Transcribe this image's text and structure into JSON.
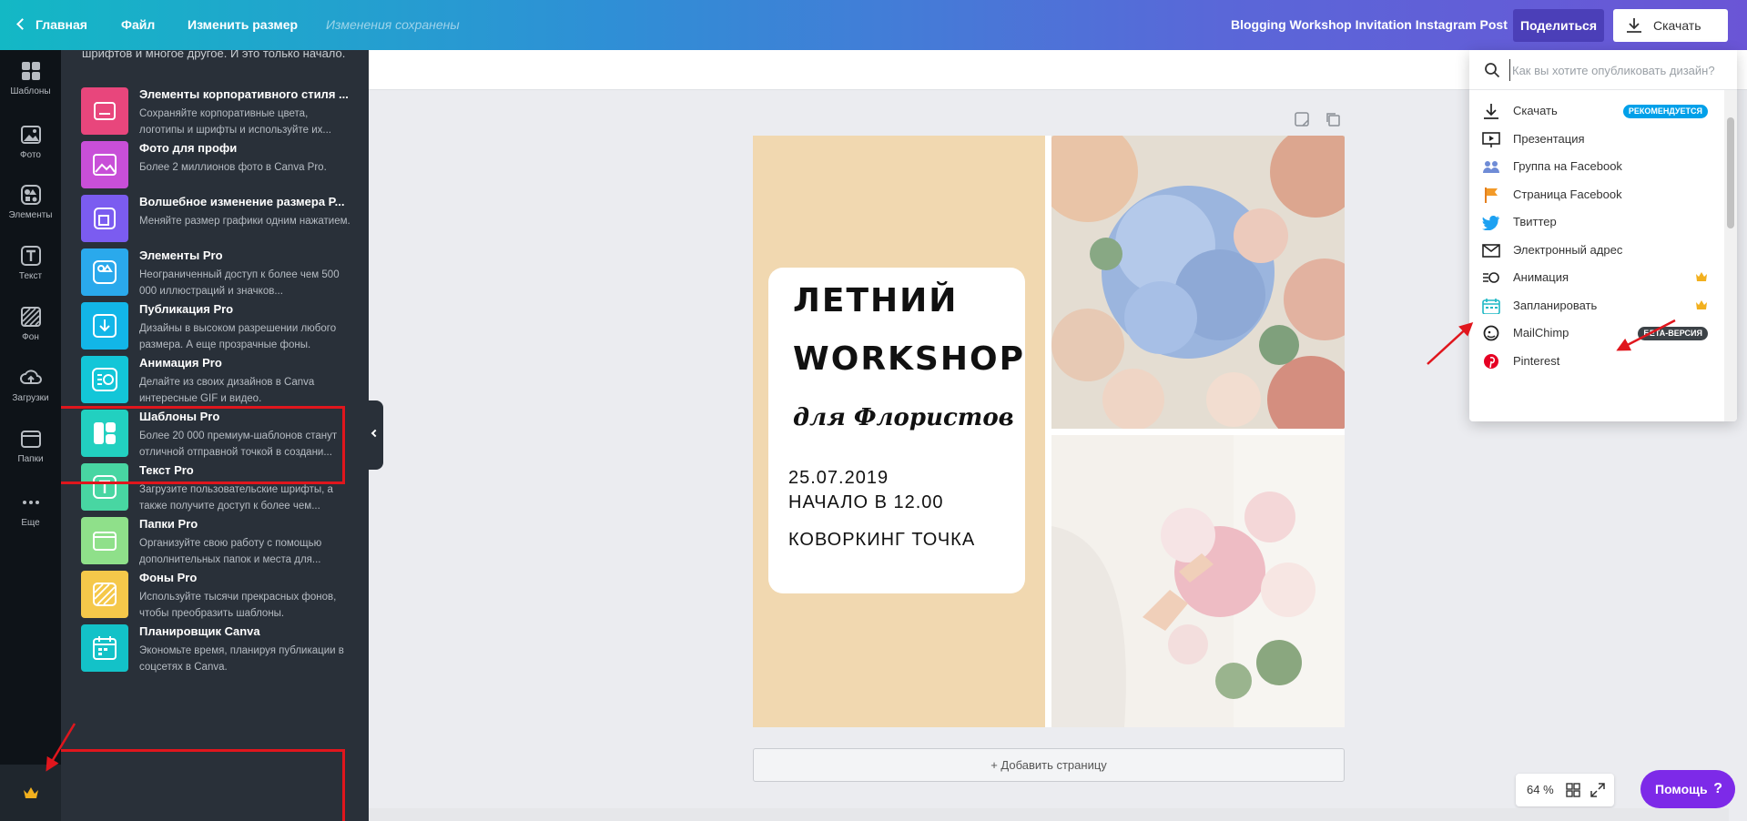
{
  "topbar": {
    "home": "Главная",
    "file": "Файл",
    "resize": "Изменить размер",
    "saved_status": "Изменения сохранены",
    "doc_title": "Blogging Workshop Invitation Instagram Post",
    "share": "Поделиться",
    "download": "Скачать"
  },
  "rail": {
    "templates": "Шаблоны",
    "photos": "Фото",
    "elements": "Элементы",
    "text": "Текст",
    "background": "Фон",
    "uploads": "Загрузки",
    "folders": "Папки",
    "more": "Еще"
  },
  "panel": {
    "intro": "шрифтов и многое другое. И это только начало.",
    "features": [
      {
        "title": "Элементы корпоративного стиля ...",
        "desc": "Сохраняйте корпоративные цвета, логотипы и шрифты и используйте их...",
        "color": "#e8467c"
      },
      {
        "title": "Фото для профи",
        "desc": "Более 2 миллионов фото в Canva Pro.",
        "color": "#c84fd8"
      },
      {
        "title": "Волшебное изменение размера P...",
        "desc": "Меняйте размер графики одним нажатием.",
        "color": "#7b5cf0"
      },
      {
        "title": "Элементы Pro",
        "desc": "Неограниченный доступ к более чем 500 000 иллюстраций и значков...",
        "color": "#2aa9ec"
      },
      {
        "title": "Публикация Pro",
        "desc": "Дизайны в высоком разрешении любого размера. А еще прозрачные фоны.",
        "color": "#12b6e8"
      },
      {
        "title": "Анимация Pro",
        "desc": "Делайте из своих дизайнов в Canva интересные GIF и видео.",
        "color": "#13c6d8"
      },
      {
        "title": "Шаблоны Pro",
        "desc": "Более 20 000 премиум-шаблонов станут отличной отправной точкой в создани...",
        "color": "#22d0c0"
      },
      {
        "title": "Текст Pro",
        "desc": "Загрузите пользовательские шрифты, а также получите доступ к более чем...",
        "color": "#48d6a2"
      },
      {
        "title": "Папки Pro",
        "desc": "Организуйте свою работу с помощью дополнительных папок и места для...",
        "color": "#8fe08a"
      },
      {
        "title": "Фоны Pro",
        "desc": "Используйте тысячи прекрасных фонов, чтобы преобразить шаблоны.",
        "color": "#f5c84a"
      },
      {
        "title": "Планировщик Canva",
        "desc": "Экономьте время, планируя публикации в соцсетях в Canva.",
        "color": "#13c2c8"
      }
    ]
  },
  "design": {
    "title_line1": "ЛЕТНИЙ",
    "title_line2": "WORKSHOP",
    "subtitle": "для Флористов",
    "date": "25.07.2019",
    "time": "НАЧАЛО В 12.00",
    "place": "КОВОРКИНГ ТОЧКА"
  },
  "add_page": "+ Добавить страницу",
  "zoom": "64 %",
  "help": "Помощь",
  "publish_menu": {
    "search_placeholder": "Как вы хотите опубликовать дизайн?",
    "items": [
      {
        "label": "Скачать",
        "icon": "download-icon",
        "badge": "РЕКОМЕНДУЕТСЯ",
        "badge_color": "#00a0e9"
      },
      {
        "label": "Презентация",
        "icon": "presentation-icon"
      },
      {
        "label": "Группа на Facebook",
        "icon": "facebook-group-icon"
      },
      {
        "label": "Страница Facebook",
        "icon": "facebook-page-icon"
      },
      {
        "label": "Твиттер",
        "icon": "twitter-icon"
      },
      {
        "label": "Электронный адрес",
        "icon": "email-icon"
      },
      {
        "label": "Анимация",
        "icon": "animation-icon",
        "pro": true
      },
      {
        "label": "Запланировать",
        "icon": "calendar-icon",
        "pro": true
      },
      {
        "label": "MailChimp",
        "icon": "mailchimp-icon",
        "badge": "БЕТА-ВЕРСИЯ",
        "badge_color": "#3c4247"
      },
      {
        "label": "Pinterest",
        "icon": "pinterest-icon"
      }
    ]
  },
  "colors": {
    "accent": "#7d2ae8",
    "highlight": "#e0161d",
    "crown": "#f2b01e"
  }
}
